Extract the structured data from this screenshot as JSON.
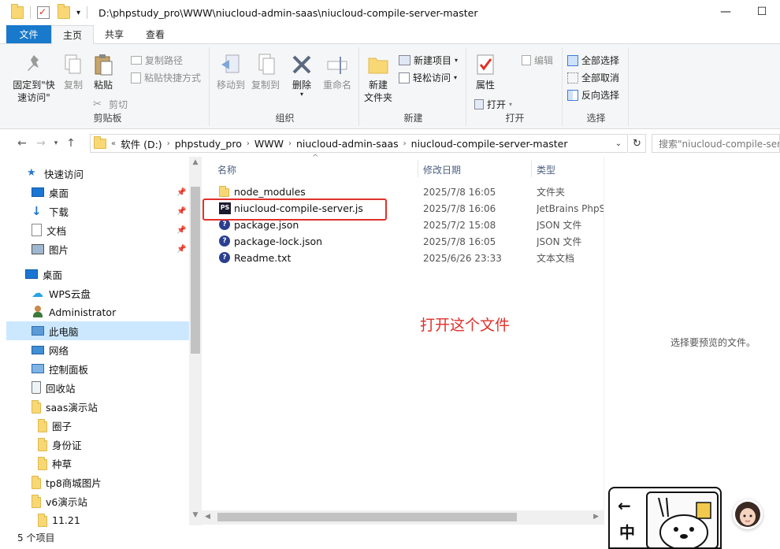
{
  "window": {
    "path": "D:\\phpstudy_pro\\WWW\\niucloud-admin-saas\\niucloud-compile-server-master",
    "minimize": "—",
    "maximize": "☐"
  },
  "tabs": [
    {
      "label": "文件"
    },
    {
      "label": "主页"
    },
    {
      "label": "共享"
    },
    {
      "label": "查看"
    }
  ],
  "ribbon": {
    "clipboard": {
      "label": "剪贴板",
      "pin_quick": "固定到\"快\n速访问\"",
      "copy": "复制",
      "paste": "粘贴",
      "copy_path": "复制路径",
      "paste_shortcut": "粘贴快捷方式",
      "cut": "剪切"
    },
    "organize": {
      "label": "组织",
      "move_to": "移动到",
      "copy_to": "复制到",
      "delete": "删除",
      "rename": "重命名"
    },
    "new": {
      "label": "新建",
      "new_folder": "新建\n文件夹",
      "new_item": "新建项目",
      "easy_access": "轻松访问"
    },
    "open": {
      "label": "打开",
      "properties": "属性",
      "open": "打开",
      "edit": "编辑"
    },
    "select": {
      "label": "选择",
      "select_all": "全部选择",
      "select_none": "全部取消",
      "invert": "反向选择"
    }
  },
  "address": {
    "crumbs": [
      "软件 (D:)",
      "phpstudy_pro",
      "WWW",
      "niucloud-admin-saas",
      "niucloud-compile-server-master"
    ],
    "search_placeholder": "搜索\"niucloud-compile-server-master\""
  },
  "nav": {
    "items": [
      {
        "label": "快速访问",
        "icon": "star-icon"
      },
      {
        "label": "桌面",
        "icon": "desktop-icon"
      },
      {
        "label": "下载",
        "icon": "download-icon"
      },
      {
        "label": "文档",
        "icon": "document-icon"
      },
      {
        "label": "图片",
        "icon": "picture-icon"
      },
      {
        "label": "桌面",
        "icon": "desktop-icon"
      },
      {
        "label": "WPS云盘",
        "icon": "cloud-icon"
      },
      {
        "label": "Administrator",
        "icon": "user-icon"
      },
      {
        "label": "此电脑",
        "icon": "computer-icon"
      },
      {
        "label": "网络",
        "icon": "network-icon"
      },
      {
        "label": "控制面板",
        "icon": "control-panel-icon"
      },
      {
        "label": "回收站",
        "icon": "recycle-bin-icon"
      },
      {
        "label": "saas演示站",
        "icon": "folder-icon"
      },
      {
        "label": "圈子",
        "icon": "folder-icon"
      },
      {
        "label": "身份证",
        "icon": "folder-icon"
      },
      {
        "label": "种草",
        "icon": "folder-icon"
      },
      {
        "label": "tp8商城图片",
        "icon": "folder-icon"
      },
      {
        "label": "v6演示站",
        "icon": "folder-icon"
      },
      {
        "label": "11.21",
        "icon": "folder-icon"
      }
    ]
  },
  "files": {
    "columns": {
      "name": "名称",
      "date": "修改日期",
      "type": "类型"
    },
    "rows": [
      {
        "name": "node_modules",
        "date": "2025/7/8 16:05",
        "type": "文件夹",
        "icon": "folder-icon"
      },
      {
        "name": "niucloud-compile-server.js",
        "date": "2025/7/8 16:06",
        "type": "JetBrains PhpStorm",
        "icon": "phpstorm-icon"
      },
      {
        "name": "package.json",
        "date": "2025/7/2 15:08",
        "type": "JSON 文件",
        "icon": "json-file-icon"
      },
      {
        "name": "package-lock.json",
        "date": "2025/7/8 16:05",
        "type": "JSON 文件",
        "icon": "json-file-icon"
      },
      {
        "name": "Readme.txt",
        "date": "2025/6/26 23:33",
        "type": "文本文档",
        "icon": "json-file-icon"
      }
    ]
  },
  "annotation": "打开这个文件",
  "preview": {
    "message": "选择要预览的文件。"
  },
  "status": {
    "count": "5 个项目"
  },
  "widget": {
    "back": "←",
    "zh": "中"
  },
  "colors": {
    "accent": "#1979ca",
    "highlight": "#e0302a",
    "selected": "#cce8ff"
  }
}
